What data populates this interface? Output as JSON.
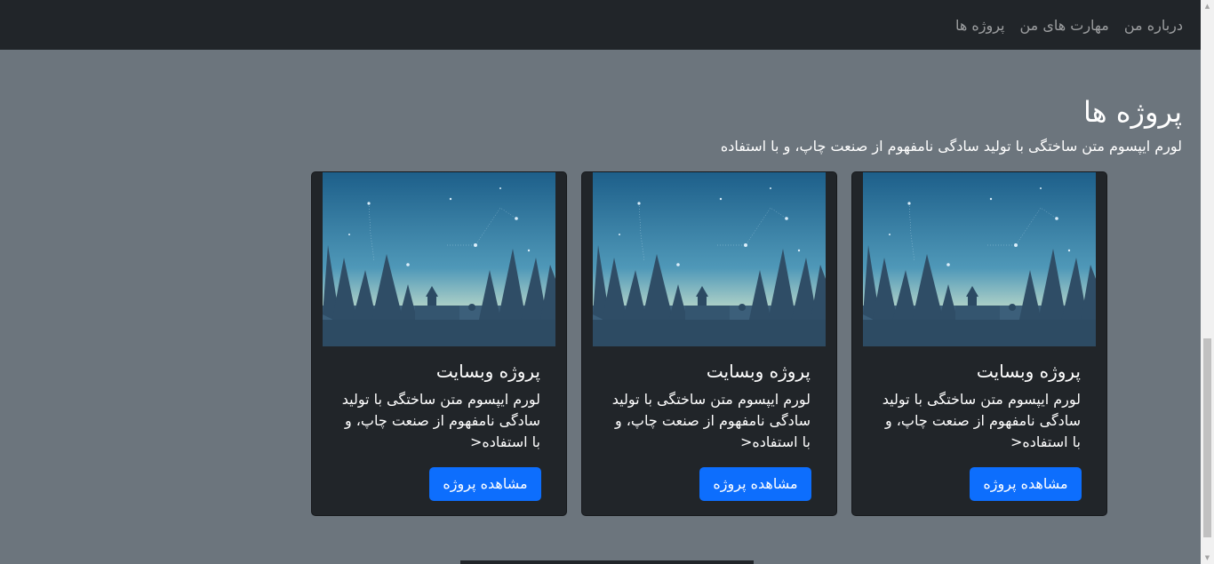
{
  "nav": {
    "items": [
      {
        "label": "درباره من"
      },
      {
        "label": "مهارت های من"
      },
      {
        "label": "پروژه ها"
      }
    ]
  },
  "projects_section": {
    "title": "پروژه ها",
    "description": "لورم ایپسوم متن ساختگی با تولید سادگی نامفهوم از صنعت چاپ، و با استفاده",
    "cards": [
      {
        "title": "پروژه وبسایت",
        "text": "لورم ایپسوم متن ساختگی با تولید سادگی نامفهوم از صنعت چاپ، و با استفاده<",
        "button_label": "مشاهده پروژه"
      },
      {
        "title": "پروژه وبسایت",
        "text": "لورم ایپسوم متن ساختگی با تولید سادگی نامفهوم از صنعت چاپ، و با استفاده<",
        "button_label": "مشاهده پروژه"
      },
      {
        "title": "پروژه وبسایت",
        "text": "لورم ایپسوم متن ساختگی با تولید سادگی نامفهوم از صنعت چاپ، و با استفاده<",
        "button_label": "مشاهده پروژه"
      }
    ]
  },
  "colors": {
    "page_background": "#6c757d",
    "navbar_background": "#212529",
    "card_background": "#212529",
    "button_primary": "#0d6efd"
  }
}
